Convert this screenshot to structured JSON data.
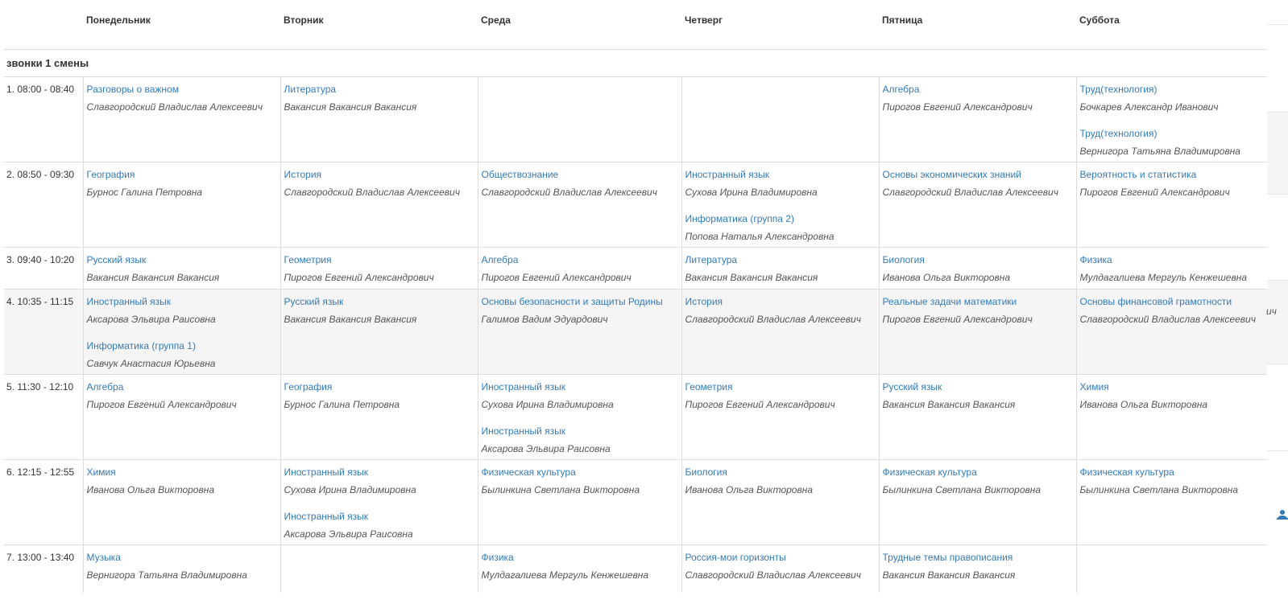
{
  "days": [
    "Понедельник",
    "Вторник",
    "Среда",
    "Четверг",
    "Пятница",
    "Суббота"
  ],
  "shift_title": "звонки 1 смены",
  "rows": [
    {
      "time": "1. 08:00 - 08:40",
      "cells": [
        [
          {
            "subject": "Разговоры о важном",
            "teacher": "Славгородский Владислав Алексеевич"
          }
        ],
        [
          {
            "subject": "Литература",
            "teacher": "Вакансия Вакансия Вакансия"
          }
        ],
        [],
        [],
        [
          {
            "subject": "Алгебра",
            "teacher": "Пирогов Евгений Александрович"
          }
        ],
        [
          {
            "subject": "Труд(технология)",
            "teacher": "Бочкарев Александр Иванович"
          },
          {
            "subject": "Труд(технология)",
            "teacher": "Вернигора Татьяна Владимировна"
          }
        ]
      ]
    },
    {
      "time": "2. 08:50 - 09:30",
      "cells": [
        [
          {
            "subject": "География",
            "teacher": "Бурнос Галина Петровна"
          }
        ],
        [
          {
            "subject": "История",
            "teacher": "Славгородский Владислав Алексеевич"
          }
        ],
        [
          {
            "subject": "Обществознание",
            "teacher": "Славгородский Владислав Алексеевич"
          }
        ],
        [
          {
            "subject": "Иностранный язык",
            "teacher": "Сухова Ирина Владимировна"
          },
          {
            "subject": "Информатика (группа 2)",
            "teacher": "Попова Наталья Александровна"
          }
        ],
        [
          {
            "subject": "Основы экономических знаний",
            "teacher": "Славгородский Владислав Алексеевич"
          }
        ],
        [
          {
            "subject": "Вероятность и статистика",
            "teacher": "Пирогов Евгений Александрович"
          }
        ]
      ]
    },
    {
      "time": "3. 09:40 - 10:20",
      "cells": [
        [
          {
            "subject": "Русский язык",
            "teacher": "Вакансия Вакансия Вакансия"
          }
        ],
        [
          {
            "subject": "Геометрия",
            "teacher": "Пирогов Евгений Александрович"
          }
        ],
        [
          {
            "subject": "Алгебра",
            "teacher": "Пирогов Евгений Александрович"
          }
        ],
        [
          {
            "subject": "Литература",
            "teacher": "Вакансия Вакансия Вакансия"
          }
        ],
        [
          {
            "subject": "Биология",
            "teacher": "Иванова Ольга Викторовна"
          }
        ],
        [
          {
            "subject": "Физика",
            "teacher": "Мулдагалиева Мергуль Кенжешевна"
          }
        ]
      ]
    },
    {
      "time": "4. 10:35 - 11:15",
      "cells": [
        [
          {
            "subject": "Иностранный язык",
            "teacher": "Аксарова Эльвира Раисовна"
          },
          {
            "subject": "Информатика (группа 1)",
            "teacher": "Савчук Анастасия Юрьевна"
          }
        ],
        [
          {
            "subject": "Русский язык",
            "teacher": "Вакансия Вакансия Вакансия"
          }
        ],
        [
          {
            "subject": "Основы безопасности и защиты Родины",
            "teacher": "Галимов Вадим Эдуардович"
          }
        ],
        [
          {
            "subject": "История",
            "teacher": "Славгородский Владислав Алексеевич"
          }
        ],
        [
          {
            "subject": "Реальные задачи математики",
            "teacher": "Пирогов Евгений Александрович"
          }
        ],
        [
          {
            "subject": "Основы финансовой грамотности",
            "teacher": "Славгородский Владислав Алексеевич"
          }
        ]
      ]
    },
    {
      "time": "5. 11:30 - 12:10",
      "cells": [
        [
          {
            "subject": "Алгебра",
            "teacher": "Пирогов Евгений Александрович"
          }
        ],
        [
          {
            "subject": "География",
            "teacher": "Бурнос Галина Петровна"
          }
        ],
        [
          {
            "subject": "Иностранный язык",
            "teacher": "Сухова Ирина Владимировна"
          },
          {
            "subject": "Иностранный язык",
            "teacher": "Аксарова Эльвира Раисовна"
          }
        ],
        [
          {
            "subject": "Геометрия",
            "teacher": "Пирогов Евгений Александрович"
          }
        ],
        [
          {
            "subject": "Русский язык",
            "teacher": "Вакансия Вакансия Вакансия"
          }
        ],
        [
          {
            "subject": "Химия",
            "teacher": "Иванова Ольга Викторовна"
          }
        ]
      ]
    },
    {
      "time": "6. 12:15 - 12:55",
      "cells": [
        [
          {
            "subject": "Химия",
            "teacher": "Иванова Ольга Викторовна"
          }
        ],
        [
          {
            "subject": "Иностранный язык",
            "teacher": "Сухова Ирина Владимировна"
          },
          {
            "subject": "Иностранный язык",
            "teacher": "Аксарова Эльвира Раисовна"
          }
        ],
        [
          {
            "subject": "Физическая культура",
            "teacher": "Былинкина Светлана Викторовна"
          }
        ],
        [
          {
            "subject": "Биология",
            "teacher": "Иванова Ольга Викторовна"
          }
        ],
        [
          {
            "subject": "Физическая культура",
            "teacher": "Былинкина Светлана Викторовна"
          }
        ],
        [
          {
            "subject": "Физическая культура",
            "teacher": "Былинкина Светлана Викторовна"
          }
        ]
      ]
    },
    {
      "time": "7. 13:00 - 13:40",
      "cells": [
        [
          {
            "subject": "Музыка",
            "teacher": "Вернигора Татьяна Владимировна"
          }
        ],
        [],
        [
          {
            "subject": "Физика",
            "teacher": "Мулдагалиева Мергуль Кенжешевна"
          }
        ],
        [
          {
            "subject": "Россия-мои горизонты",
            "teacher": "Славгородский Владислав Алексеевич"
          }
        ],
        [
          {
            "subject": "Трудные темы правописания",
            "teacher": "Вакансия Вакансия Вакансия"
          }
        ],
        []
      ]
    }
  ],
  "right_rail": {
    "clipped_text": "ич",
    "icon": "user-icon",
    "icon_color": "#337ab7"
  },
  "colors": {
    "link": "#337ab7",
    "teacher": "#555555",
    "border": "#dddddd",
    "highlight_row": "#f5f5f5"
  }
}
